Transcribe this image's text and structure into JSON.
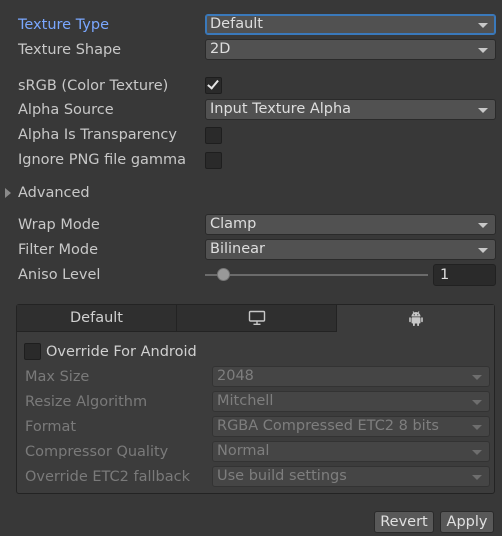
{
  "fields": {
    "texture_type": {
      "label": "Texture Type",
      "value": "Default"
    },
    "texture_shape": {
      "label": "Texture Shape",
      "value": "2D"
    },
    "srgb": {
      "label": "sRGB (Color Texture)",
      "checked": true
    },
    "alpha_source": {
      "label": "Alpha Source",
      "value": "Input Texture Alpha"
    },
    "alpha_is_transparency": {
      "label": "Alpha Is Transparency",
      "checked": false
    },
    "ignore_png_gamma": {
      "label": "Ignore PNG file gamma",
      "checked": false
    },
    "advanced": {
      "label": "Advanced"
    },
    "wrap_mode": {
      "label": "Wrap Mode",
      "value": "Clamp"
    },
    "filter_mode": {
      "label": "Filter Mode",
      "value": "Bilinear"
    },
    "aniso_level": {
      "label": "Aniso Level",
      "value": "1"
    }
  },
  "platform": {
    "tabs": [
      "Default",
      "",
      ""
    ],
    "tab_icons": [
      "",
      "monitor-icon",
      "android-icon"
    ],
    "selected_tab": 2,
    "override": {
      "label": "Override For Android",
      "checked": false
    },
    "rows": [
      {
        "label": "Max Size",
        "value": "2048"
      },
      {
        "label": "Resize Algorithm",
        "value": "Mitchell"
      },
      {
        "label": "Format",
        "value": "RGBA Compressed ETC2 8 bits"
      },
      {
        "label": "Compressor Quality",
        "value": "Normal"
      },
      {
        "label": "Override ETC2 fallback",
        "value": "Use build settings"
      }
    ]
  },
  "buttons": {
    "revert": "Revert",
    "apply": "Apply"
  },
  "colors": {
    "background": "#383838",
    "focus": "#3a79bb",
    "active_label": "#7aa7ff"
  }
}
